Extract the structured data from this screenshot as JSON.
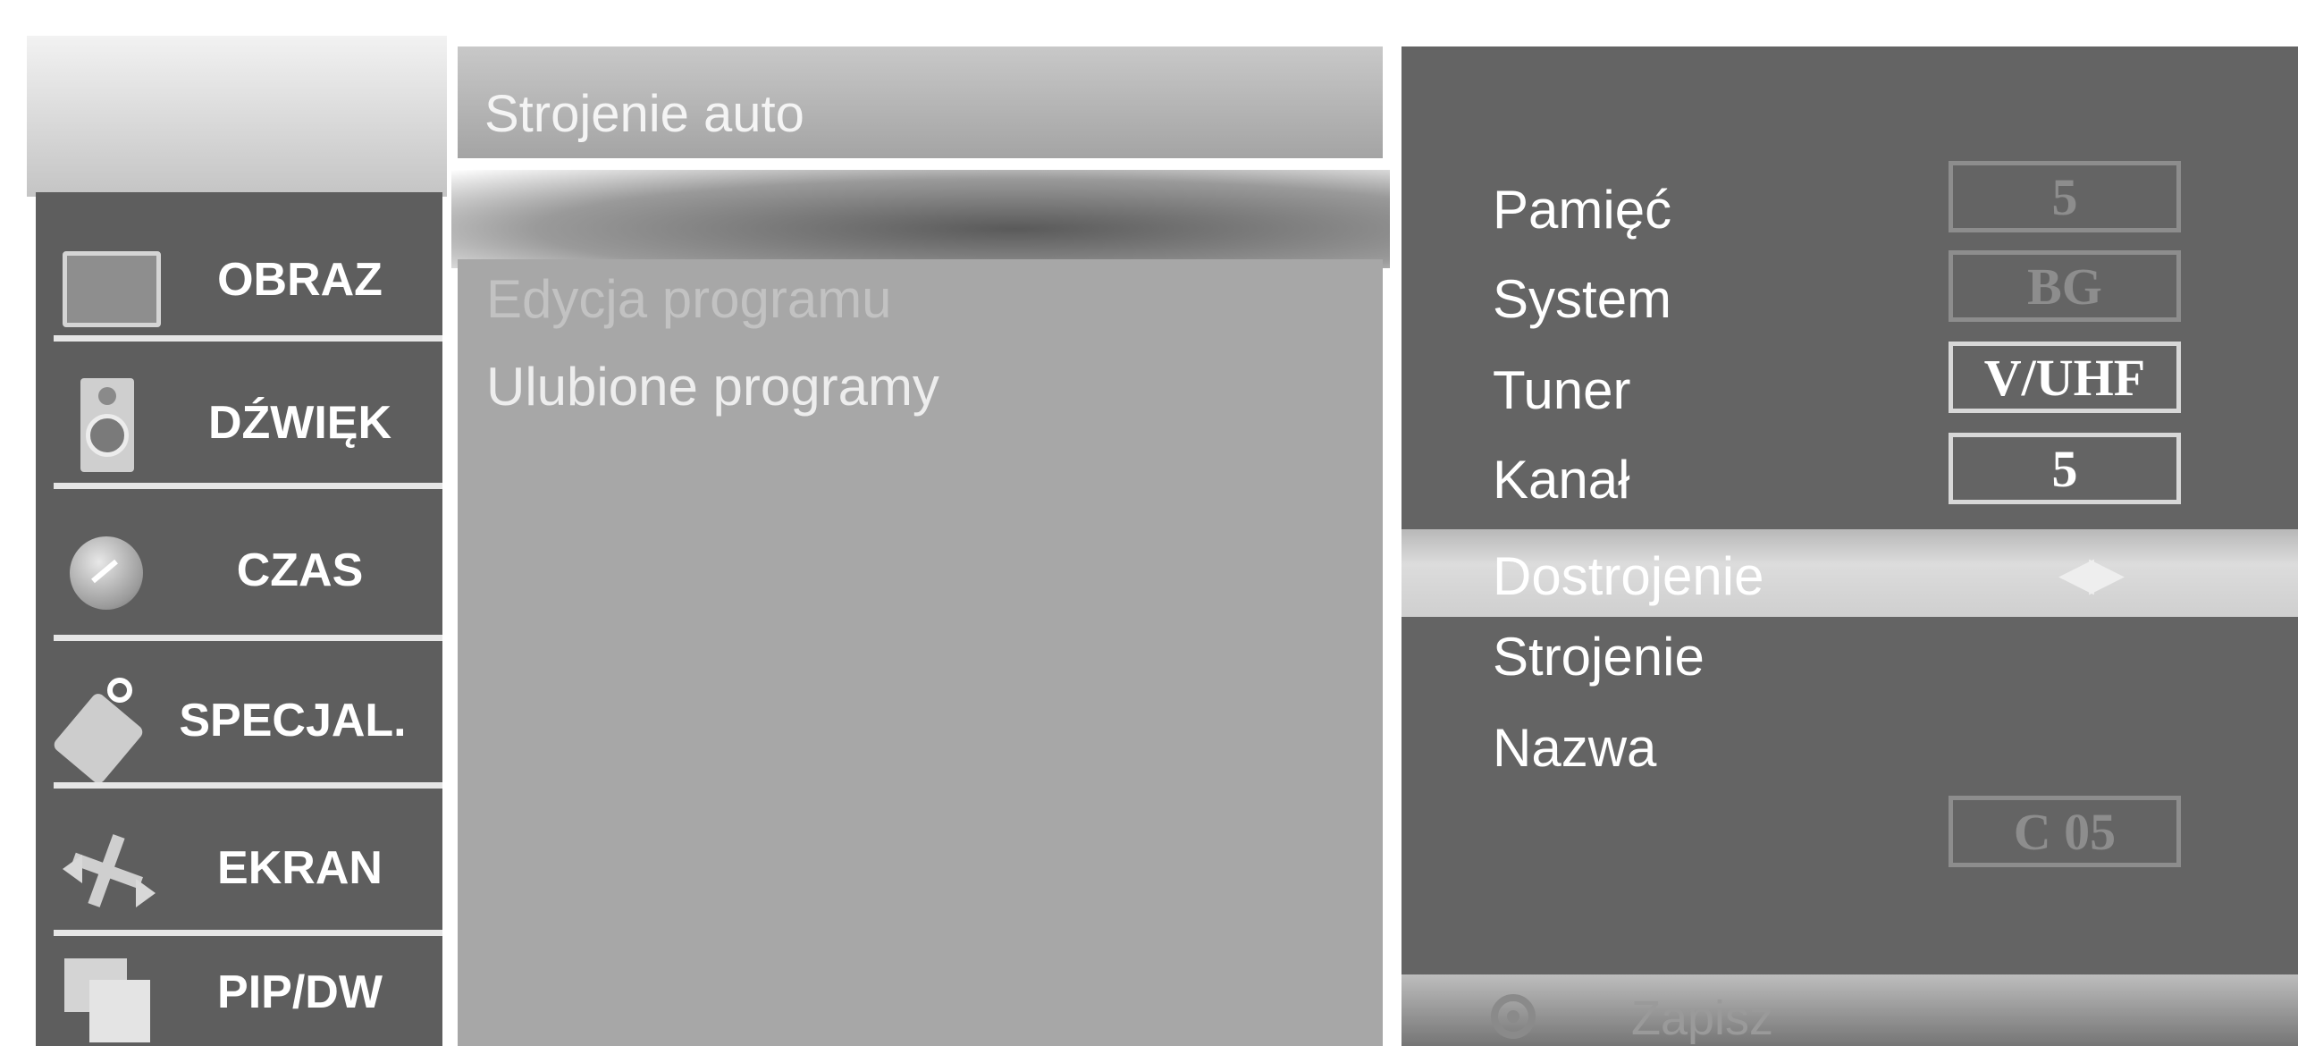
{
  "sidebar": {
    "items": [
      {
        "label": "OBRAZ",
        "icon": "picture-icon"
      },
      {
        "label": "DŹWIĘK",
        "icon": "speaker-icon"
      },
      {
        "label": "CZAS",
        "icon": "clock-icon"
      },
      {
        "label": "SPECJAL.",
        "icon": "tag-icon"
      },
      {
        "label": "EKRAN",
        "icon": "move-arrows-icon"
      },
      {
        "label": "PIP/DW",
        "icon": "pip-icon"
      }
    ]
  },
  "middle": {
    "header": "Strojenie auto",
    "items": [
      "Edycja programu",
      "Ulubione programy"
    ]
  },
  "right": {
    "rows": [
      {
        "label": "Pamięć",
        "value": "5"
      },
      {
        "label": "System",
        "value": "BG"
      },
      {
        "label": "Tuner",
        "value": "V/UHF"
      },
      {
        "label": "Kanał",
        "value": "5"
      }
    ],
    "highlight": {
      "label": "Dostrojenie",
      "arrows": "◀▶"
    },
    "strojenie_label": "Strojenie",
    "nazwa_label": "Nazwa",
    "nazwa_value": "C 05",
    "save_label": "Zapisz"
  },
  "colors": {
    "sidebar_bg": "#5e5e5e",
    "middle_bg": "#a7a7a7",
    "right_bg": "#646464",
    "highlight": "#d0d0d0"
  }
}
